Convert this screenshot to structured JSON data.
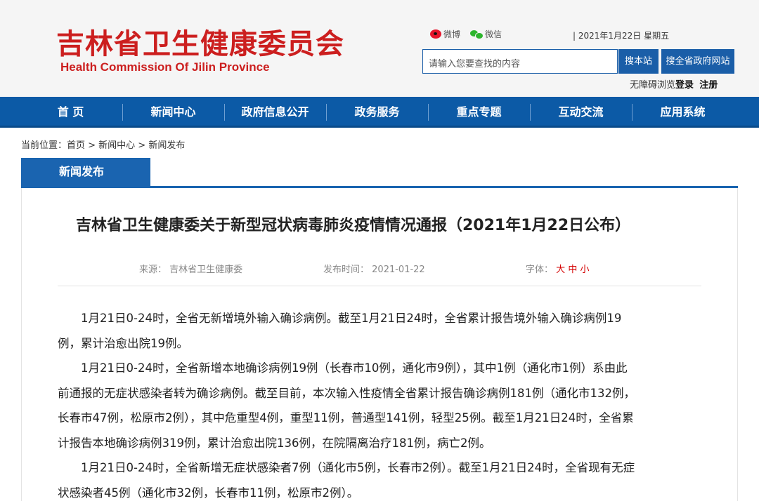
{
  "header": {
    "title_cn": "吉林省卫生健康委员会",
    "title_en": "Health Commission Of Jilin Province",
    "social": [
      {
        "label": "微博",
        "icon": "weibo-icon"
      },
      {
        "label": "微信",
        "icon": "wechat-icon"
      }
    ],
    "date_text": "| 2021年1月22日 星期五",
    "search": {
      "placeholder": "请输入您要查找的内容",
      "button": "搜本站",
      "button_all": "搜全省政府网站"
    },
    "accessibility": "无障碍浏览",
    "login": "登录",
    "register": "注册"
  },
  "nav": {
    "items": [
      "首 页",
      "新闻中心",
      "政府信息公开",
      "政务服务",
      "重点专题",
      "互动交流",
      "应用系统"
    ]
  },
  "breadcrumb": "当前位置：首页 > 新闻中心 > 新闻发布",
  "section_tab": "新闻发布",
  "article": {
    "title": "吉林省卫生健康委关于新型冠状病毒肺炎疫情情况通报（2021年1月22日公布）",
    "source_label": "来源：",
    "source": "吉林省卫生健康委",
    "date_label": "发布时间：",
    "date": "2021-01-22",
    "font_label": "字体：",
    "font_sizes": [
      "大",
      "中",
      "小"
    ],
    "paragraphs": [
      {
        "lines": [
          "　　1月21日0-24时，全省无新增境外输入确诊病例。截至1月21日24时，全省累计报告境外输入确诊病例19",
          "例，累计治愈出院19例。"
        ]
      },
      {
        "lines": [
          "　　1月21日0-24时，全省新增本地确诊病例19例（长春市10例，通化市9例），其中1例（通化市1例）系由此",
          "前通报的无症状感染者转为确诊病例。截至目前，本次输入性疫情全省累计报告确诊病例181例（通化市132例，",
          "长春市47例，松原市2例），其中危重型4例，重型11例，普通型141例，轻型25例。截至1月21日24时，全省累",
          "计报告本地确诊病例319例，累计治愈出院136例，在院隔离治疗181例，病亡2例。"
        ]
      },
      {
        "lines": [
          "　　1月21日0-24时，全省新增无症状感染者7例（通化市5例，长春市2例）。截至1月21日24时，全省现有无症",
          "状感染者45例（通化市32例，长春市11例，松原市2例）。"
        ]
      }
    ]
  },
  "colors": {
    "brand_red": "#cc1f1f",
    "nav_blue": "#0c5aa6",
    "tab_blue": "#1a64b0"
  }
}
